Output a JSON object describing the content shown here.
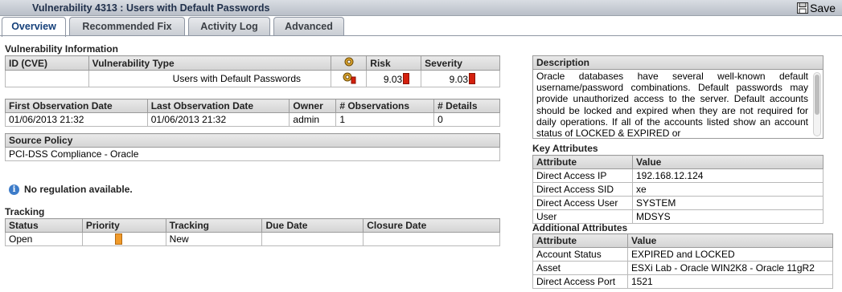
{
  "window": {
    "title": "Vulnerability 4313 : Users with Default Passwords",
    "save_label": "Save"
  },
  "tabs": [
    {
      "label": "Overview",
      "active": true
    },
    {
      "label": "Recommended Fix",
      "active": false
    },
    {
      "label": "Activity Log",
      "active": false
    },
    {
      "label": "Advanced",
      "active": false
    }
  ],
  "vulnerability_info": {
    "heading": "Vulnerability Information",
    "headers": {
      "id": "ID (CVE)",
      "type": "Vulnerability Type",
      "risk": "Risk",
      "severity": "Severity"
    },
    "row": {
      "id": "",
      "type": "Users with Default Passwords",
      "risk": "9.03",
      "severity": "9.03"
    }
  },
  "observations": {
    "headers": [
      "First Observation Date",
      "Last Observation Date",
      "Owner",
      "# Observations",
      "# Details"
    ],
    "row": [
      "01/06/2013 21:32",
      "01/06/2013 21:32",
      "admin",
      "1",
      "0"
    ]
  },
  "source_policy": {
    "header": "Source Policy",
    "value": "PCI-DSS Compliance - Oracle"
  },
  "regulation_note": "No regulation available.",
  "tracking": {
    "heading": "Tracking",
    "headers": [
      "Status",
      "Priority",
      "Tracking",
      "Due Date",
      "Closure Date"
    ],
    "row": {
      "status": "Open",
      "tracking": "New",
      "due_date": "",
      "closure_date": ""
    }
  },
  "description": {
    "header": "Description",
    "text": "Oracle databases have several well-known default username/password combinations. Default passwords may provide unauthorized access to the server. Default accounts should be locked and expired when they are not required for daily operations. If all of the accounts listed show an account status of LOCKED & EXPIRED or"
  },
  "key_attributes": {
    "heading": "Key Attributes",
    "headers": [
      "Attribute",
      "Value"
    ],
    "rows": [
      [
        "Direct Access IP",
        "192.168.12.124"
      ],
      [
        "Direct Access SID",
        "xe"
      ],
      [
        "Direct Access User",
        "SYSTEM"
      ],
      [
        "User",
        "MDSYS"
      ]
    ]
  },
  "additional_attributes": {
    "heading": "Additional Attributes",
    "headers": [
      "Attribute",
      "Value"
    ],
    "rows": [
      [
        "Account Status",
        "EXPIRED and LOCKED"
      ],
      [
        "Asset",
        "ESXi Lab - Oracle WIN2K8 - Oracle 11gR2"
      ],
      [
        "Direct Access Port",
        "1521"
      ]
    ]
  },
  "colors": {
    "risk": "#d4200d",
    "priority": "#f09a2a",
    "active_tab_text": "#15407a",
    "info_icon": "#3d7cc9"
  },
  "icons": {
    "save": "floppy-disk-icon",
    "type_header": "gears-icon",
    "type_row": "gears-risk-icon",
    "info": "info-icon"
  }
}
